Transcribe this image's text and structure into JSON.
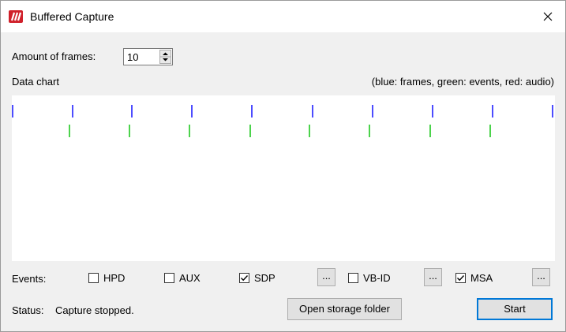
{
  "window": {
    "title": "Buffered Capture"
  },
  "frames": {
    "label": "Amount of frames:",
    "value": "10"
  },
  "chart": {
    "label": "Data chart",
    "legend": "(blue: frames, green: events, red: audio)",
    "colors": {
      "frames": "#0000ff",
      "events": "#00c000",
      "audio": "#ff0000"
    }
  },
  "events": {
    "label": "Events:",
    "items": [
      {
        "label": "HPD",
        "checked": false
      },
      {
        "label": "AUX",
        "checked": false
      },
      {
        "label": "SDP",
        "checked": true
      },
      {
        "label": "VB-ID",
        "checked": false
      },
      {
        "label": "MSA",
        "checked": true
      }
    ],
    "more_label": "..."
  },
  "status": {
    "label": "Status:",
    "text": "Capture stopped."
  },
  "buttons": {
    "open_storage": "Open storage folder",
    "start": "Start"
  },
  "icons": {
    "close": "close-icon",
    "app": "app-logo-icon",
    "spin": "spin-updown-icon",
    "check": "check-icon"
  }
}
